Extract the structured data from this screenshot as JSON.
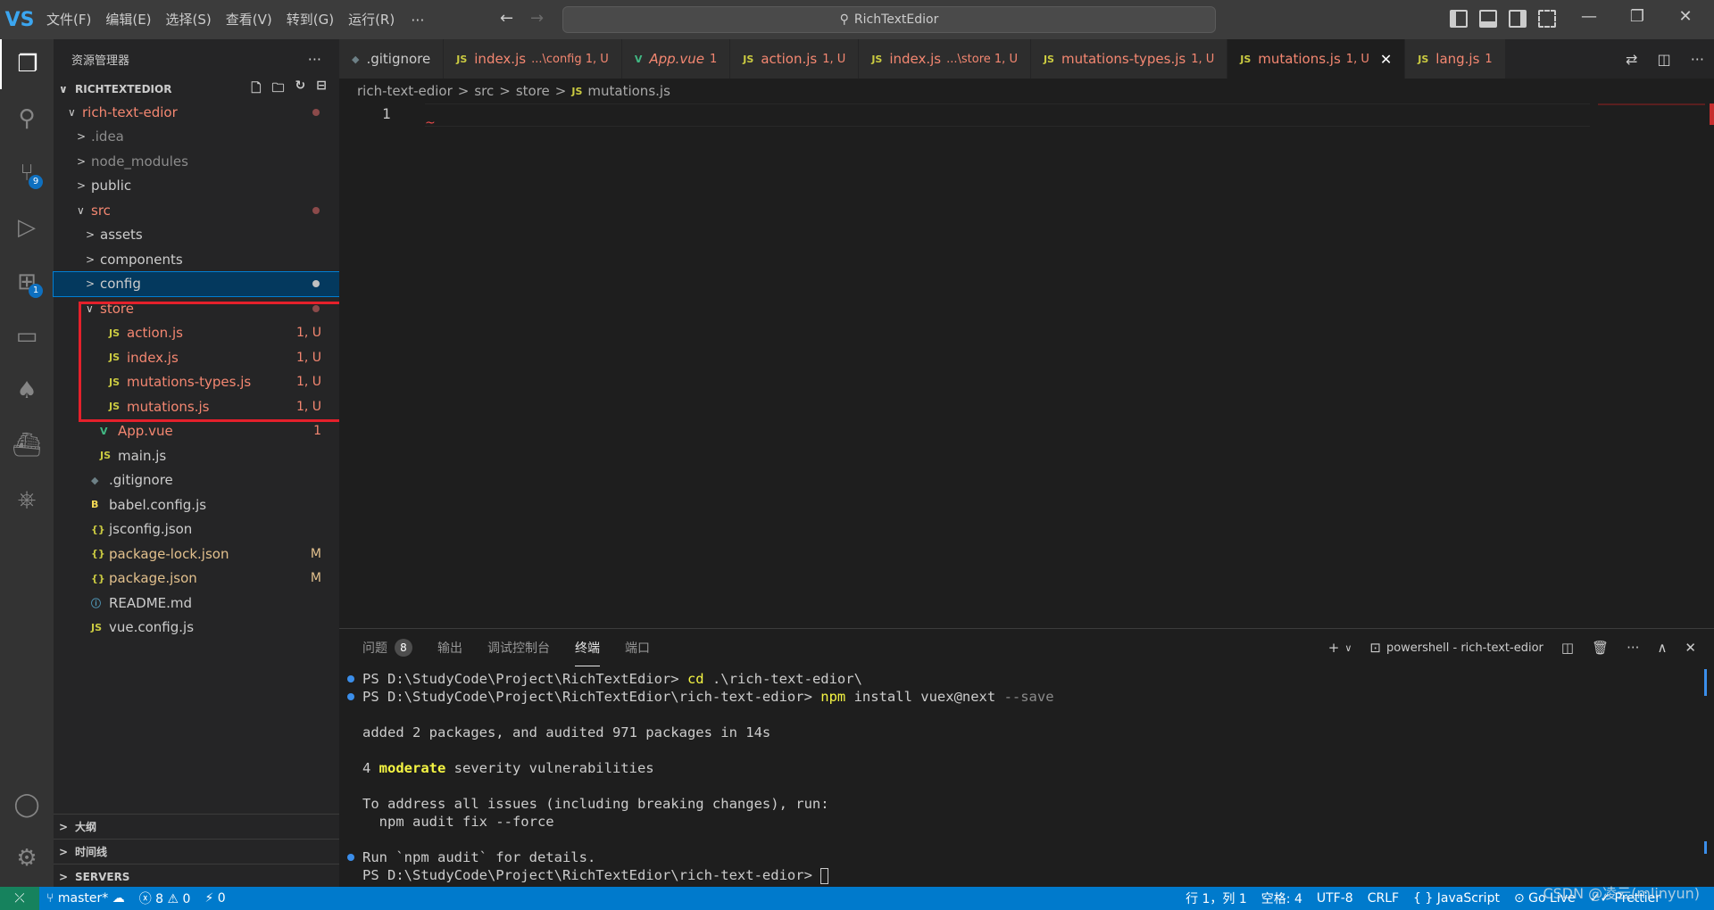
{
  "titlebar": {
    "logo": "VS",
    "menu": [
      "文件(F)",
      "编辑(E)",
      "选择(S)",
      "查看(V)",
      "转到(G)",
      "运行(R)"
    ],
    "more": "···",
    "back": "←",
    "forward": "→",
    "search_text": "RichTextEdior",
    "search_icon": "⚲",
    "min": "—",
    "restore": "❐",
    "close": "✕"
  },
  "activitybar": {
    "items": [
      {
        "icon": "files-icon",
        "glyph": "❐"
      },
      {
        "icon": "search-icon",
        "glyph": "⚲"
      },
      {
        "icon": "source-control-icon",
        "glyph": "⑂",
        "badge": "9"
      },
      {
        "icon": "run-debug-icon",
        "glyph": "▷"
      },
      {
        "icon": "extensions-icon",
        "glyph": "⊞",
        "badge": "1"
      },
      {
        "icon": "remote-explorer-icon",
        "glyph": "▭"
      },
      {
        "icon": "mongodb-icon",
        "glyph": "♠"
      },
      {
        "icon": "docker-icon",
        "glyph": "⛴"
      },
      {
        "icon": "kubernetes-icon",
        "glyph": "⎈"
      }
    ],
    "account_glyph": "◯",
    "settings_glyph": "⚙"
  },
  "sidebar": {
    "title": "资源管理器",
    "more": "···",
    "root": "RICHTEXTEDIOR",
    "root_actions": [
      "🗋",
      "🗀",
      "↻",
      "⊟"
    ],
    "tree": [
      {
        "label": "rich-text-edior",
        "indent": 1,
        "chev": "∨",
        "icon": "",
        "color": "c-red",
        "dot": true
      },
      {
        "label": ".idea",
        "indent": 2,
        "chev": ">",
        "icon": "",
        "color": "c-dim"
      },
      {
        "label": "node_modules",
        "indent": 2,
        "chev": ">",
        "icon": "",
        "color": "c-dim"
      },
      {
        "label": "public",
        "indent": 2,
        "chev": ">",
        "icon": "",
        "color": "c-def"
      },
      {
        "label": "src",
        "indent": 2,
        "chev": "∨",
        "icon": "",
        "color": "c-red",
        "dot": true
      },
      {
        "label": "assets",
        "indent": 3,
        "chev": ">",
        "icon": "",
        "color": "c-def"
      },
      {
        "label": "components",
        "indent": 3,
        "chev": ">",
        "icon": "",
        "color": "c-def"
      },
      {
        "label": "config",
        "indent": 3,
        "chev": ">",
        "icon": "",
        "color": "c-def",
        "dot": true,
        "selected": true
      },
      {
        "label": "store",
        "indent": 3,
        "chev": "∨",
        "icon": "",
        "color": "c-red",
        "dot": true
      },
      {
        "label": "action.js",
        "indent": 4,
        "chev": "",
        "icon": "JS",
        "iconColor": "c-js",
        "color": "c-red",
        "badge": "1, U"
      },
      {
        "label": "index.js",
        "indent": 4,
        "chev": "",
        "icon": "JS",
        "iconColor": "c-js",
        "color": "c-red",
        "badge": "1, U"
      },
      {
        "label": "mutations-types.js",
        "indent": 4,
        "chev": "",
        "icon": "JS",
        "iconColor": "c-js",
        "color": "c-red",
        "badge": "1, U"
      },
      {
        "label": "mutations.js",
        "indent": 4,
        "chev": "",
        "icon": "JS",
        "iconColor": "c-js",
        "color": "c-red",
        "badge": "1, U"
      },
      {
        "label": "App.vue",
        "indent": 3,
        "chev": "",
        "icon": "V",
        "iconColor": "c-vue",
        "color": "c-red",
        "badge": "1"
      },
      {
        "label": "main.js",
        "indent": 3,
        "chev": "",
        "icon": "JS",
        "iconColor": "c-js",
        "color": "c-def"
      },
      {
        "label": ".gitignore",
        "indent": 2,
        "chev": "",
        "icon": "◆",
        "iconColor": "c-git",
        "color": "c-def"
      },
      {
        "label": "babel.config.js",
        "indent": 2,
        "chev": "",
        "icon": "B",
        "iconColor": "c-babel",
        "color": "c-def"
      },
      {
        "label": "jsconfig.json",
        "indent": 2,
        "chev": "",
        "icon": "{}",
        "iconColor": "c-json",
        "color": "c-def"
      },
      {
        "label": "package-lock.json",
        "indent": 2,
        "chev": "",
        "icon": "{}",
        "iconColor": "c-json",
        "color": "c-mod",
        "badge": "M",
        "badgeColor": "c-mod"
      },
      {
        "label": "package.json",
        "indent": 2,
        "chev": "",
        "icon": "{}",
        "iconColor": "c-json",
        "color": "c-mod",
        "badge": "M",
        "badgeColor": "c-mod"
      },
      {
        "label": "README.md",
        "indent": 2,
        "chev": "",
        "icon": "ⓘ",
        "iconColor": "c-info",
        "color": "c-def"
      },
      {
        "label": "vue.config.js",
        "indent": 2,
        "chev": "",
        "icon": "JS",
        "iconColor": "c-js",
        "color": "c-def"
      }
    ],
    "outline": "大纲",
    "timeline": "时间线",
    "servers": "SERVERS"
  },
  "tabs": [
    {
      "icon": "◆",
      "iconColor": "c-git",
      "label": ".gitignore",
      "labelColor": "c-def",
      "desc": ""
    },
    {
      "icon": "JS",
      "iconColor": "c-js",
      "label": "index.js",
      "labelColor": "c-red",
      "desc": "...\\config  1, U"
    },
    {
      "icon": "V",
      "iconColor": "c-vue",
      "label": "App.vue",
      "labelColor": "c-red",
      "desc": "1",
      "italic": true
    },
    {
      "icon": "JS",
      "iconColor": "c-js",
      "label": "action.js",
      "labelColor": "c-red",
      "desc": "1, U"
    },
    {
      "icon": "JS",
      "iconColor": "c-js",
      "label": "index.js",
      "labelColor": "c-red",
      "desc": "...\\store  1, U"
    },
    {
      "icon": "JS",
      "iconColor": "c-js",
      "label": "mutations-types.js",
      "labelColor": "c-red",
      "desc": "1, U"
    },
    {
      "icon": "JS",
      "iconColor": "c-js",
      "label": "mutations.js",
      "labelColor": "c-red",
      "desc": "1, U",
      "active": true,
      "close": "✕"
    },
    {
      "icon": "JS",
      "iconColor": "c-js",
      "label": "lang.js",
      "labelColor": "c-red",
      "desc": "1"
    }
  ],
  "tab_actions": [
    "⇄",
    "◫",
    "···"
  ],
  "breadcrumb": {
    "parts": [
      "rich-text-edior",
      "src",
      "store"
    ],
    "file_icon": "JS",
    "file": "mutations.js",
    "sep": ">"
  },
  "editor": {
    "line_number": "1",
    "squiggle": "~"
  },
  "panel": {
    "tabs": [
      {
        "label": "问题",
        "badge": "8"
      },
      {
        "label": "输出"
      },
      {
        "label": "调试控制台"
      },
      {
        "label": "终端",
        "active": true
      },
      {
        "label": "端口"
      }
    ],
    "add": "+",
    "dropdown": "∨",
    "shell_icon": "⊡",
    "shell": "powershell - rich-text-edior",
    "split": "◫",
    "trash": "🗑",
    "more": "···",
    "maximize": "∧",
    "close": "✕"
  },
  "terminal": [
    {
      "mark": true,
      "segments": [
        {
          "t": "PS D:\\StudyCode\\Project\\RichTextEdior> ",
          "c": ""
        },
        {
          "t": "cd",
          "c": "t-yellow"
        },
        {
          "t": " .\\rich-text-edior\\",
          "c": ""
        }
      ]
    },
    {
      "mark": true,
      "segments": [
        {
          "t": "PS D:\\StudyCode\\Project\\RichTextEdior\\rich-text-edior> ",
          "c": ""
        },
        {
          "t": "npm",
          "c": "t-yellow"
        },
        {
          "t": " install vuex@next ",
          "c": ""
        },
        {
          "t": "--save",
          "c": "t-gray"
        }
      ]
    },
    {
      "segments": [
        {
          "t": "",
          "c": ""
        }
      ]
    },
    {
      "segments": [
        {
          "t": "added 2 packages, and audited 971 packages in 14s",
          "c": ""
        }
      ]
    },
    {
      "segments": [
        {
          "t": "",
          "c": ""
        }
      ]
    },
    {
      "segments": [
        {
          "t": "4 ",
          "c": ""
        },
        {
          "t": "moderate",
          "c": "t-bold-yellow"
        },
        {
          "t": " severity vulnerabilities",
          "c": ""
        }
      ]
    },
    {
      "segments": [
        {
          "t": "",
          "c": ""
        }
      ]
    },
    {
      "segments": [
        {
          "t": "To address all issues (including breaking changes), run:",
          "c": ""
        }
      ]
    },
    {
      "segments": [
        {
          "t": "  npm audit fix --force",
          "c": ""
        }
      ]
    },
    {
      "segments": [
        {
          "t": "",
          "c": ""
        }
      ]
    },
    {
      "mark": true,
      "segments": [
        {
          "t": "Run `npm audit` for details.",
          "c": ""
        }
      ]
    },
    {
      "segments": [
        {
          "t": "PS D:\\StudyCode\\Project\\RichTextEdior\\rich-text-edior> ",
          "c": ""
        }
      ],
      "cursor": true
    }
  ],
  "statusbar": {
    "remote": "⤫",
    "branch_icon": "⑂",
    "branch": "master*",
    "sync": "☁",
    "errors_icon": "ⓧ",
    "errors": "8",
    "warnings_icon": "⚠",
    "warnings": "0",
    "ports_icon": "⚡",
    "ports": "0",
    "position": "行 1，列 1",
    "spaces": "空格: 4",
    "encoding": "UTF-8",
    "eol": "CRLF",
    "language": "{ } JavaScript",
    "golive": "⊙ Go Live",
    "prettier": "✓✓ Prettier",
    "watermark": "CSDN @凌云(mlinyun)"
  }
}
